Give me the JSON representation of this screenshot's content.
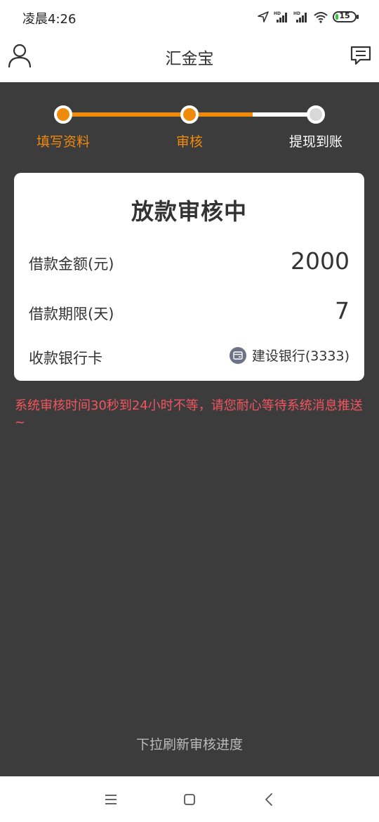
{
  "status_bar": {
    "time": "凌晨4:26",
    "battery": "15",
    "battery_level": 0.15,
    "icons": [
      "location-icon",
      "signal-hd-icon",
      "signal-hd-icon",
      "wifi-icon",
      "battery-icon"
    ]
  },
  "nav": {
    "title": "汇金宝",
    "left_icon": "user-icon",
    "right_icon": "message-icon"
  },
  "steps": {
    "items": [
      {
        "label": "填写资料",
        "state": "done"
      },
      {
        "label": "审核",
        "state": "current"
      },
      {
        "label": "提现到账",
        "state": "pending"
      }
    ],
    "active_color": "#f08a0c",
    "inactive_color": "#ffffff"
  },
  "card": {
    "title": "放款审核中",
    "rows": [
      {
        "label": "借款金额(元)",
        "value": "2000"
      },
      {
        "label": "借款期限(天)",
        "value": "7"
      },
      {
        "label": "收款银行卡",
        "value": "建设银行(3333)",
        "icon": "bank-card-icon"
      }
    ]
  },
  "notice": "系统审核时间30秒到24小时不等，请您耐心等待系统消息推送~",
  "refresh_hint": "下拉刷新审核进度",
  "colors": {
    "background": "#3c3c3c",
    "accent": "#f08a0c",
    "notice": "#f2555f"
  }
}
